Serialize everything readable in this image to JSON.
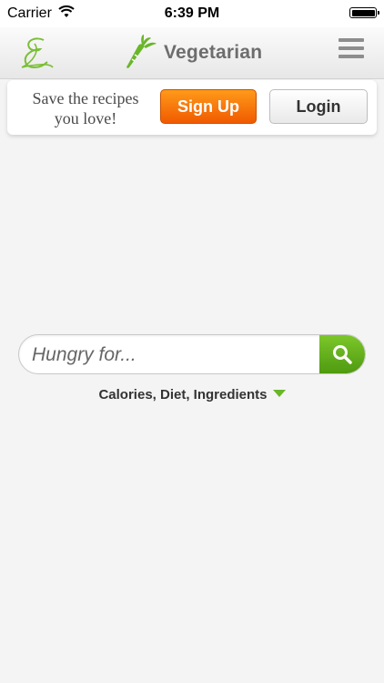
{
  "status_bar": {
    "carrier": "Carrier",
    "time": "6:39 PM"
  },
  "nav": {
    "title": "Vegetarian",
    "logo_icon": "script-e-logo-icon",
    "brand_icon": "carrot-icon",
    "menu_icon": "hamburger-menu-icon"
  },
  "banner": {
    "text_line1": "Save the recipes",
    "text_line2": "you love!",
    "signup_label": "Sign Up",
    "login_label": "Login"
  },
  "search": {
    "placeholder": "Hungry for...",
    "value": "",
    "icon": "search-icon"
  },
  "filters": {
    "label": "Calories, Diet, Ingredients",
    "icon": "dropdown-triangle-icon"
  },
  "colors": {
    "accent_green": "#6ab62a",
    "signup_orange": "#f57a00",
    "background": "#f4f4f4"
  }
}
